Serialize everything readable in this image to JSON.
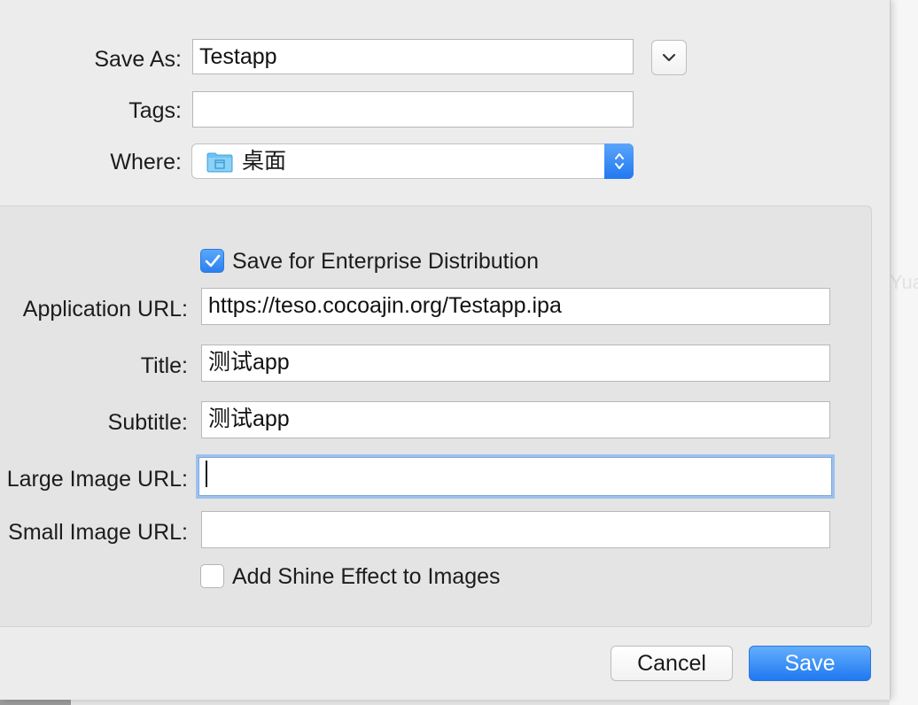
{
  "backdrop": {
    "ghost_text": "Yua"
  },
  "dialog": {
    "save_as": {
      "label": "Save As:",
      "value": "Testapp"
    },
    "tags": {
      "label": "Tags:",
      "value": ""
    },
    "where": {
      "label": "Where:",
      "value": "桌面",
      "icon": "folder-icon"
    }
  },
  "enterprise": {
    "distribution_checkbox": {
      "label": "Save for Enterprise Distribution",
      "checked": true
    },
    "application_url": {
      "label": "Application URL:",
      "value": "https://teso.cocoajin.org/Testapp.ipa"
    },
    "title": {
      "label": "Title:",
      "value": "测试app"
    },
    "subtitle": {
      "label": "Subtitle:",
      "value": "测试app"
    },
    "large_image_url": {
      "label": "Large Image URL:",
      "value": ""
    },
    "small_image_url": {
      "label": "Small Image URL:",
      "value": ""
    },
    "shine_checkbox": {
      "label": "Add Shine Effect to Images",
      "checked": false
    }
  },
  "buttons": {
    "cancel": "Cancel",
    "save": "Save"
  },
  "colors": {
    "accent": "#2a80f1",
    "focus_ring": "#9cc1ee",
    "panel": "#e4e4e4"
  }
}
